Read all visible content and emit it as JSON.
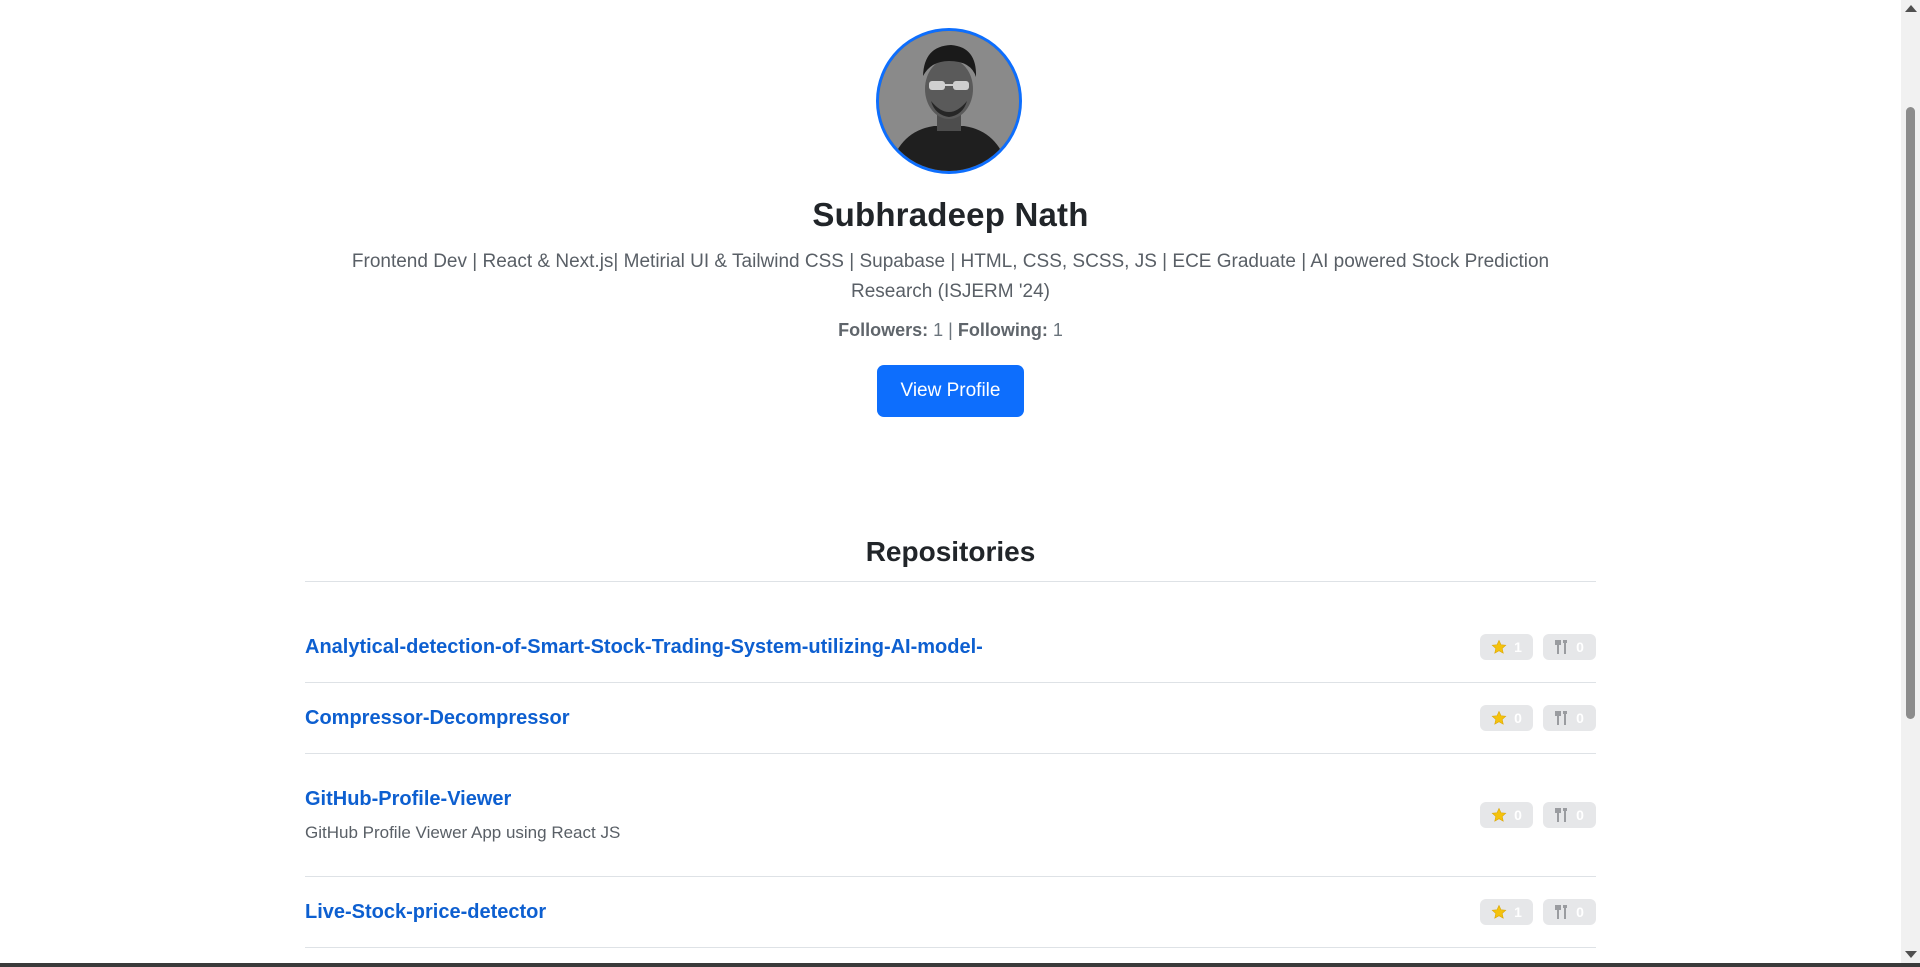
{
  "profile": {
    "name": "Subhradeep Nath",
    "bio": "Frontend Dev | React & Next.js| Metirial UI & Tailwind CSS | Supabase | HTML, CSS, SCSS, JS | ECE Graduate | AI powered Stock Prediction Research (ISJERM '24)",
    "followers_label": "Followers:",
    "followers": "1",
    "separator": "|",
    "following_label": "Following:",
    "following": "1",
    "view_profile_label": "View Profile",
    "avatar_icon": "profile-photo"
  },
  "repositories": {
    "title": "Repositories",
    "items": [
      {
        "name": "Analytical-detection-of-Smart-Stock-Trading-System-utilizing-AI-model-",
        "description": "",
        "stars": "1",
        "forks": "0"
      },
      {
        "name": "Compressor-Decompressor",
        "description": "",
        "stars": "0",
        "forks": "0"
      },
      {
        "name": "GitHub-Profile-Viewer",
        "description": "GitHub Profile Viewer App using React JS",
        "stars": "0",
        "forks": "0"
      },
      {
        "name": "Live-Stock-price-detector",
        "description": "",
        "stars": "1",
        "forks": "0"
      }
    ]
  },
  "colors": {
    "accent": "#0d6efd",
    "link": "#0d5fd0",
    "badge_bg": "#e6e7e9",
    "star": "#f4c20d"
  },
  "icons": {
    "star": "star-icon",
    "fork": "fork-icon"
  }
}
